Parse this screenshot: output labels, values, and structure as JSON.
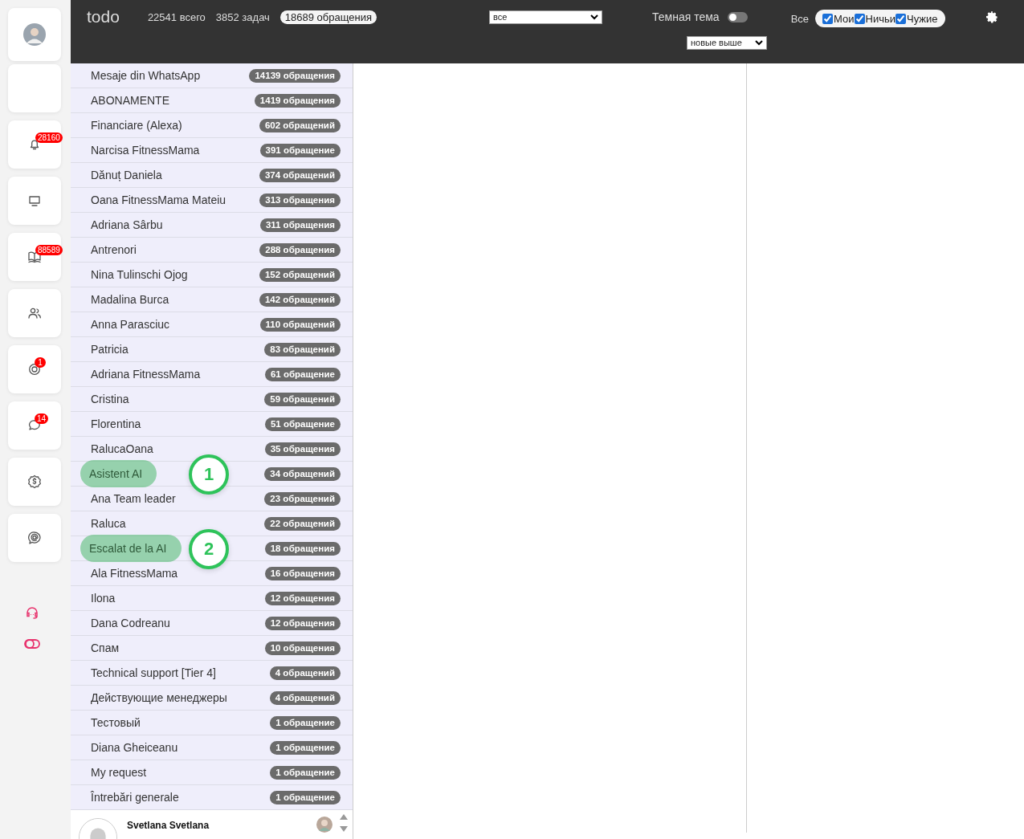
{
  "header": {
    "logo": "todo",
    "total": "22541 всего",
    "tasks": "3852 задач",
    "requests": "18689 обращения",
    "filter": {
      "value": "все"
    },
    "dark_theme": {
      "label": "Темная тема",
      "on": false
    },
    "scope_label": "Все",
    "scopes": [
      {
        "label": "Мои",
        "checked": true
      },
      {
        "label": "Ничьи",
        "checked": true
      },
      {
        "label": "Чужие",
        "checked": true
      }
    ],
    "sort": {
      "value": "новые выше"
    }
  },
  "sidebar": {
    "items": [
      {
        "kind": "avatar"
      },
      {
        "kind": "blank"
      },
      {
        "kind": "bell",
        "badge": "28160"
      },
      {
        "kind": "monitor"
      },
      {
        "kind": "book",
        "badge": "88589"
      },
      {
        "kind": "users"
      },
      {
        "kind": "target",
        "badge": "1"
      },
      {
        "kind": "chat",
        "badge": "14"
      },
      {
        "kind": "dollar"
      },
      {
        "kind": "at-chat"
      }
    ],
    "footer_icons": [
      {
        "kind": "headset"
      },
      {
        "kind": "toggle"
      }
    ]
  },
  "queues": [
    {
      "name": "Mesaje din WhatsApp",
      "count": "14139 обращения",
      "highlighted": false
    },
    {
      "name": "ABONAMENTE",
      "count": "1419 обращения",
      "highlighted": false
    },
    {
      "name": "Financiare (Alexa)",
      "count": "602 обращений",
      "highlighted": false
    },
    {
      "name": "Narcisa FitnessMama",
      "count": "391 обращение",
      "highlighted": false
    },
    {
      "name": "Dănuț Daniela",
      "count": "374 обращений",
      "highlighted": false
    },
    {
      "name": "Oana FitnessMama Mateiu",
      "count": "313 обращения",
      "highlighted": false
    },
    {
      "name": "Adriana Sârbu",
      "count": "311 обращения",
      "highlighted": false
    },
    {
      "name": "Antrenori",
      "count": "288 обращения",
      "highlighted": false
    },
    {
      "name": "Nina Tulinschi Ojog",
      "count": "152 обращений",
      "highlighted": false
    },
    {
      "name": "Madalina Burca",
      "count": "142 обращений",
      "highlighted": false
    },
    {
      "name": "Anna Parasciuc",
      "count": "110 обращений",
      "highlighted": false
    },
    {
      "name": "Patricia",
      "count": "83 обращений",
      "highlighted": false
    },
    {
      "name": "Adriana FitnessMama",
      "count": "61 обращение",
      "highlighted": false
    },
    {
      "name": "Cristina",
      "count": "59 обращений",
      "highlighted": false
    },
    {
      "name": "Florentina",
      "count": "51 обращение",
      "highlighted": false
    },
    {
      "name": "RalucaOana",
      "count": "35 обращения",
      "highlighted": false
    },
    {
      "name": "Asistent AI",
      "count": "34 обращений",
      "highlighted": true,
      "callout": "1"
    },
    {
      "name": "Ana Team leader",
      "count": "23 обращений",
      "highlighted": false
    },
    {
      "name": "Raluca",
      "count": "22 обращений",
      "highlighted": false
    },
    {
      "name": "Escalat de la AI",
      "count": "18 обращения",
      "highlighted": true,
      "callout": "2"
    },
    {
      "name": "Ala FitnessMama",
      "count": "16 обращения",
      "highlighted": false
    },
    {
      "name": "Ilona",
      "count": "12 обращения",
      "highlighted": false
    },
    {
      "name": "Dana Codreanu",
      "count": "12 обращения",
      "highlighted": false
    },
    {
      "name": "Спам",
      "count": "10 обращения",
      "highlighted": false
    },
    {
      "name": "Technical support [Tier 4]",
      "count": "4 обращений",
      "highlighted": false
    },
    {
      "name": "Действующие менеджеры",
      "count": "4 обращений",
      "highlighted": false
    },
    {
      "name": "Тестовый",
      "count": "1 обращение",
      "highlighted": false
    },
    {
      "name": "Diana Gheiceanu",
      "count": "1 обращение",
      "highlighted": false
    },
    {
      "name": "My request",
      "count": "1 обращение",
      "highlighted": false
    },
    {
      "name": "Întrebări generale",
      "count": "1 обращение",
      "highlighted": false
    }
  ],
  "chat_preview": {
    "name": "Svetlana Svetlana"
  }
}
